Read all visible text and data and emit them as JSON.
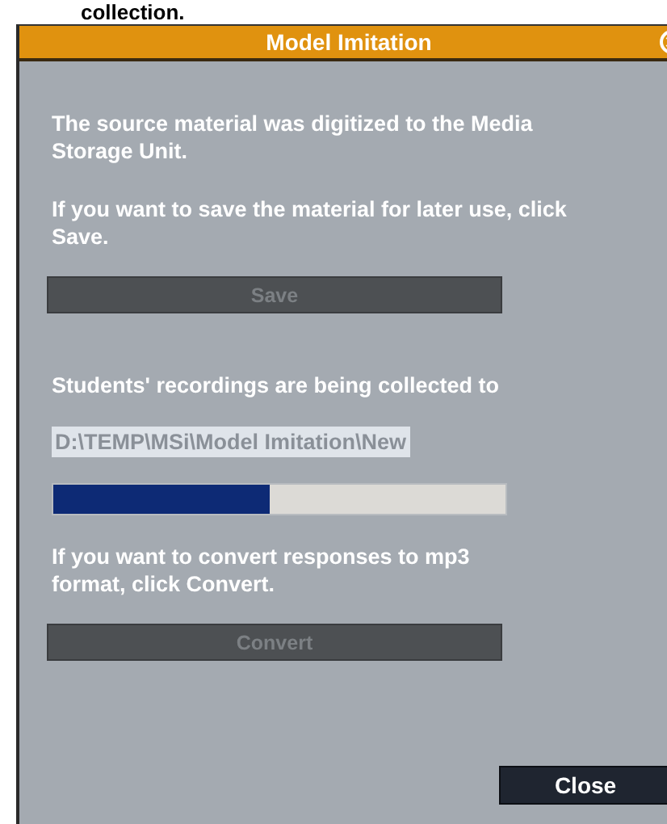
{
  "page_text": "collection.",
  "window": {
    "title": "Model Imitation"
  },
  "paragraphs": [
    {
      "text": "The source material was digitized to the Media Storage Unit."
    },
    {
      "text": "If you want to save the material for later use, click Save."
    }
  ],
  "save_button": {
    "label": "Save",
    "disabled": true
  },
  "collect_label": "Students' recordings are being collected to",
  "path_field": {
    "value": "D:\\TEMP\\MSi\\Model Imitation\\New"
  },
  "progress": {
    "level": 0.48
  },
  "convert_text": "If you want to convert responses to mp3 format, click Convert.",
  "convert_button": {
    "label": "Convert",
    "disabled": true
  },
  "close_button": {
    "label": "Close",
    "disabled": false
  }
}
